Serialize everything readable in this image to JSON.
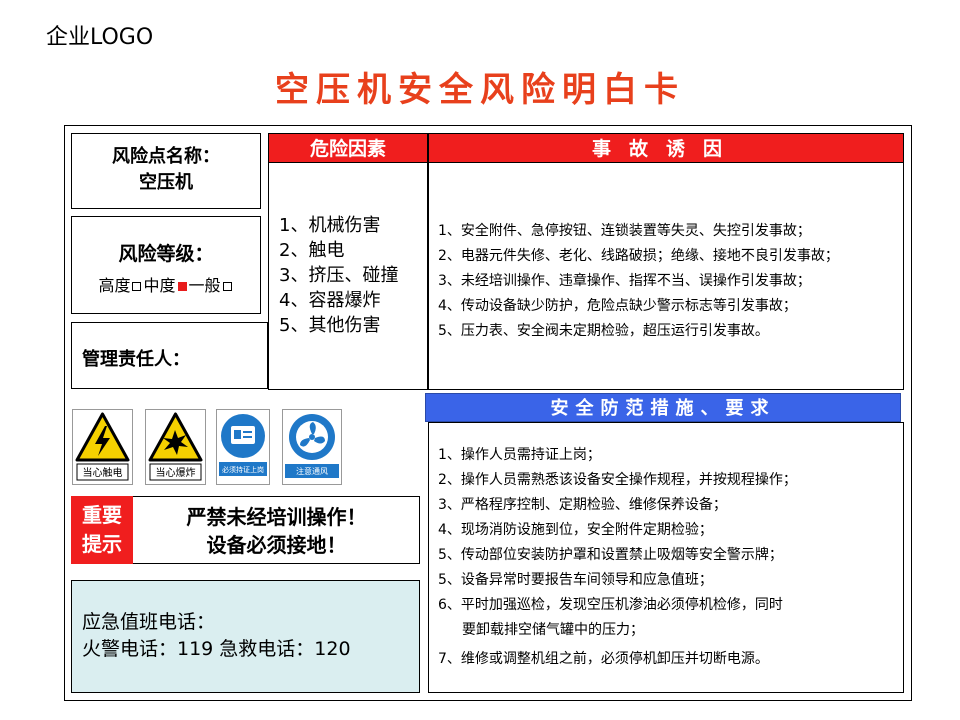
{
  "logo": "企业LOGO",
  "title": "空压机安全风险明白卡",
  "risk_point": {
    "label": "风险点名称：",
    "value": "空压机"
  },
  "risk_level": {
    "label": "风险等级：",
    "options": [
      "高度",
      "中度",
      "一般"
    ],
    "selected": "中度"
  },
  "manager": {
    "label": "管理责任人："
  },
  "hazards": {
    "header": "危险因素",
    "items": [
      "1、机械伤害",
      "2、触电",
      "3、挤压、碰撞",
      "4、容器爆炸",
      "5、其他伤害"
    ]
  },
  "causes": {
    "header": "事故诱因",
    "items": [
      "1、安全附件、急停按钮、连锁装置等失灵、失控引发事故；",
      "2、电器元件失修、老化、线路破损；绝缘、接地不良引发事故；",
      "3、未经培训操作、违章操作、指挥不当、误操作引发事故；",
      "4、传动设备缺少防护，危险点缺少警示标志等引发事故；",
      "5、压力表、安全阀未定期检验，超压运行引发事故。"
    ]
  },
  "measures": {
    "header": "安全防范措施、要求",
    "items": [
      "1、操作人员需持证上岗；",
      "2、操作人员需熟悉该设备安全操作规程，并按规程操作；",
      "3、严格程序控制、定期检验、维修保养设备；",
      "4、现场消防设施到位，安全附件定期检验；",
      "5、传动部位安装防护罩和设置禁止吸烟等安全警示牌；",
      "5、设备异常时要报告车间领导和应急值班；",
      "6、平时加强巡检，发现空压机渗油必须停机检修，同时",
      "要卸载排空储气罐中的压力；",
      "7、维修或调整机组之前，必须停机卸压并切断电源。"
    ]
  },
  "signs": [
    {
      "icon": "electric-shock-warning-icon",
      "caption": "当心触电"
    },
    {
      "icon": "explosion-warning-icon",
      "caption": "当心爆炸"
    },
    {
      "icon": "certified-operation-icon",
      "caption": "必须持证上岗"
    },
    {
      "icon": "ventilation-icon",
      "caption": "注意通风"
    }
  ],
  "notice": {
    "tag_line1": "重要",
    "tag_line2": "提示",
    "line1": "严禁未经培训操作！",
    "line2": "设备必须接地！"
  },
  "emergency": {
    "line1": "应急值班电话：",
    "line2": "火警电话：119  急救电话：120"
  },
  "colors": {
    "title": "#e8401c",
    "red_header": "#f01e1e",
    "blue_header": "#3a64e8",
    "emergency_bg": "#daeef0"
  }
}
